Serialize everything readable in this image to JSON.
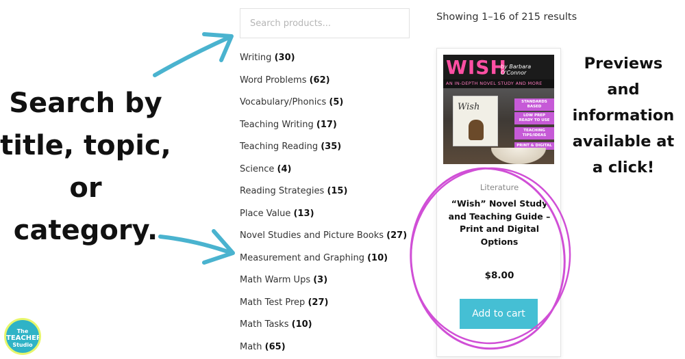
{
  "left_caption": {
    "lines": [
      "Search by",
      "title, topic,",
      "or",
      "category."
    ]
  },
  "search": {
    "placeholder": "Search products..."
  },
  "categories": [
    {
      "name": "Writing",
      "count": "(30)"
    },
    {
      "name": "Word Problems",
      "count": "(62)"
    },
    {
      "name": "Vocabulary/Phonics",
      "count": "(5)"
    },
    {
      "name": "Teaching Writing",
      "count": "(17)"
    },
    {
      "name": "Teaching Reading",
      "count": "(35)"
    },
    {
      "name": "Science",
      "count": "(4)"
    },
    {
      "name": "Reading Strategies",
      "count": "(15)"
    },
    {
      "name": "Place Value",
      "count": "(13)"
    },
    {
      "name": "Novel Studies and Picture Books",
      "count": "(27)"
    },
    {
      "name": "Measurement and Graphing",
      "count": "(10)"
    },
    {
      "name": "Math Warm Ups",
      "count": "(3)"
    },
    {
      "name": "Math Test Prep",
      "count": "(27)"
    },
    {
      "name": "Math Tasks",
      "count": "(10)"
    },
    {
      "name": "Math",
      "count": "(65)"
    }
  ],
  "results": {
    "text": "Showing 1–16 of 215 results"
  },
  "product": {
    "cover": {
      "title": "WISH",
      "author": "by Barbara O'Connor",
      "subtitle": "AN IN-DEPTH NOVEL STUDY AND MORE",
      "book_title": "Wish",
      "ribbons": [
        "STANDARDS BASED",
        "LOW PREP READY TO USE",
        "TEACHING TIPS/IDEAS",
        "PRINT & DIGITAL"
      ]
    },
    "category": "Literature",
    "title": "“Wish” Novel Study and Teaching Guide – Print and Digital Options",
    "price": "$8.00",
    "add_to_cart": "Add to cart"
  },
  "right_caption": {
    "lines": [
      "Previews",
      "and",
      "information",
      "available at",
      "a click!"
    ]
  },
  "logo": {
    "line1": "The",
    "line2": "TEACHER",
    "line3": "Studio"
  },
  "colors": {
    "arrow": "#4ab3cf",
    "button": "#45bfd4",
    "circle": "#d04fd6",
    "cover_title": "#ff4fa3"
  }
}
